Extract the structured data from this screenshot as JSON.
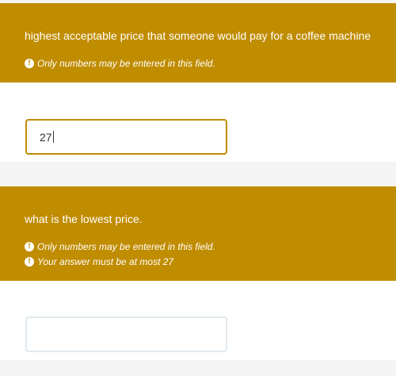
{
  "colors": {
    "header_background": "#c08c00",
    "body_background": "#ffffff",
    "page_background": "#f4f4f4",
    "active_input_border": "#c08c00",
    "inactive_input_border": "#dfe8ee"
  },
  "questions": [
    {
      "text": "highest acceptable price that someone would pay for a coffee machine",
      "tips": [
        {
          "icon": "exclamation-circle-icon",
          "text": "Only numbers may be entered in this field."
        }
      ],
      "answer": {
        "value": "27",
        "focused": true
      }
    },
    {
      "text": "what is the lowest price.",
      "tips": [
        {
          "icon": "exclamation-circle-icon",
          "text": "Only numbers may be entered in this field."
        },
        {
          "icon": "exclamation-circle-icon",
          "text": "Your answer must be at most 27"
        }
      ],
      "answer": {
        "value": "",
        "focused": false
      }
    }
  ]
}
